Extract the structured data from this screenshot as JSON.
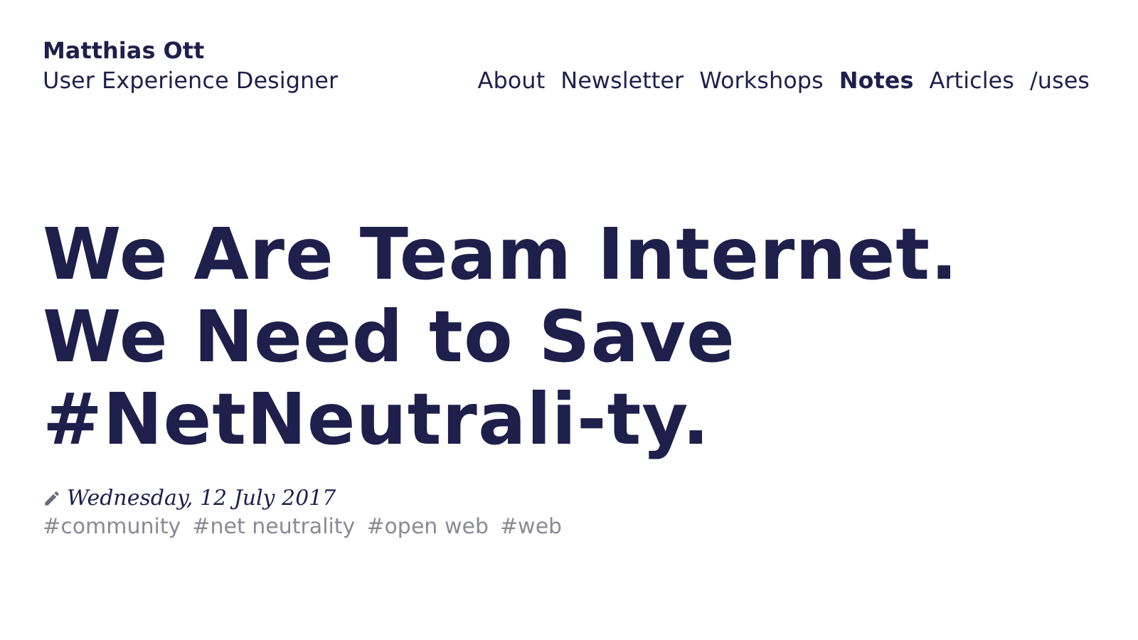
{
  "site": {
    "name": "Matthias Ott",
    "tagline": "User Experience Designer"
  },
  "nav": [
    {
      "label": "About",
      "selected": false
    },
    {
      "label": "Newsletter",
      "selected": false
    },
    {
      "label": "Workshops",
      "selected": false
    },
    {
      "label": "Notes",
      "selected": true
    },
    {
      "label": "Articles",
      "selected": false
    },
    {
      "label": "/uses",
      "selected": false
    }
  ],
  "article": {
    "title": "We Are Team Internet. We Need to Save #NetNeutrali-ty.",
    "date": "Wednesday, 12 July 2017",
    "tags": [
      "#community",
      "#net neutrality",
      "#open web",
      "#web"
    ]
  }
}
